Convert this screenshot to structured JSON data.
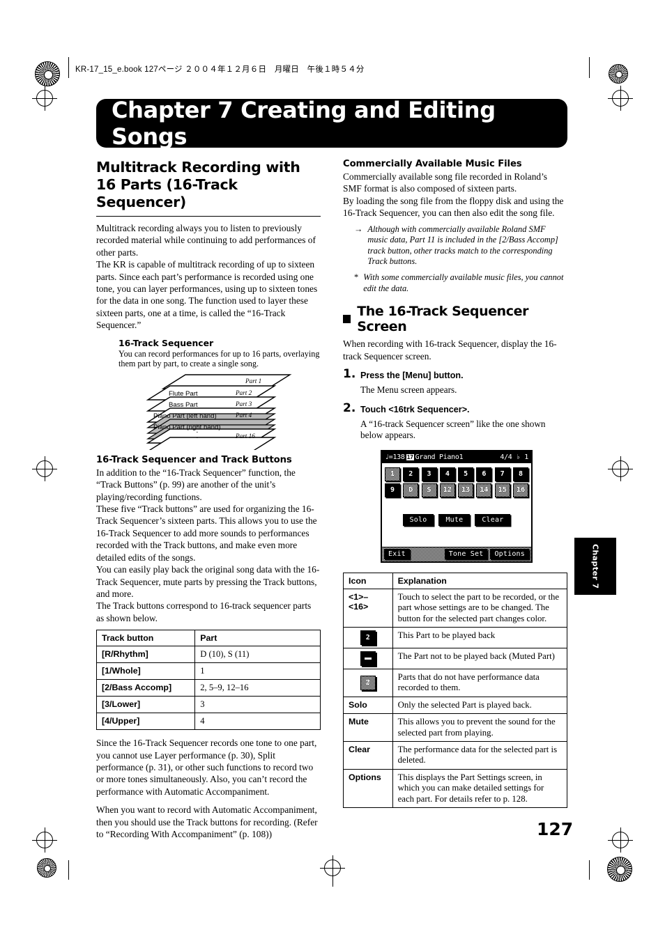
{
  "slug": {
    "text": "KR-17_15_e.book 127ページ ２００４年１２月６日　月曜日　午後１時５４分"
  },
  "chapter": {
    "banner_title": "Chapter 7 Creating and Editing Songs",
    "thumb_tab": "Chapter 7",
    "page_number": "127"
  },
  "left": {
    "section_title": "Multitrack Recording with 16 Parts (16-Track Sequencer)",
    "paras": [
      "Multitrack recording always you to listen to previously recorded material while continuing to add performances of other parts.",
      "The KR is capable of multitrack recording of up to sixteen parts. Since each part’s performance is recorded using one tone, you can layer performances, using up to sixteen tones for the data in one song. The function used to layer these sixteen parts, one at a time, is called the “16-Track Sequencer.”"
    ],
    "figure": {
      "caption": "16-Track Sequencer",
      "description": "You can record performances for up to 16 parts, overlaying them part by part, to create a single song.",
      "layer_labels": [
        "Flute Part",
        "Bass Part",
        "Piano Part (left hand)",
        "Piano Part (right hand)"
      ],
      "part_labels": [
        "Part 1",
        "Part 2",
        "Part 3",
        "Part 4",
        "Part 16"
      ]
    },
    "subsection_title": "16-Track Sequencer and Track Buttons",
    "sub_paras": [
      "In addition to the “16-Track Sequencer” function, the “Track Buttons” (p. 99) are another of the unit’s playing/recording functions.",
      "These five “Track buttons” are used for organizing the 16-Track Sequencer’s sixteen parts. This allows you to use the 16-Track Sequencer to add more sounds to performances recorded with the Track buttons, and make even more detailed edits of the songs.",
      "You can easily play back the original song data with the 16-Track Sequencer, mute parts by pressing the Track buttons, and more.",
      "The Track buttons correspond to 16-track sequencer parts as shown below."
    ],
    "track_table": {
      "headers": [
        "Track button",
        "Part"
      ],
      "rows": [
        [
          "[R/Rhythm]",
          "D (10), S (11)"
        ],
        [
          "[1/Whole]",
          "1"
        ],
        [
          "[2/Bass Accomp]",
          "2, 5–9, 12–16"
        ],
        [
          "[3/Lower]",
          "3"
        ],
        [
          "[4/Upper]",
          "4"
        ]
      ]
    },
    "closing_paras": [
      "Since the 16-Track Sequencer records one tone to one part, you cannot use Layer performance (p. 30), Split performance (p. 31), or other such functions to record two or more tones simultaneously. Also, you can’t record the performance with Automatic Accompaniment.",
      "When you want to record with Automatic Accompaniment, then you should use the Track buttons for recording. (Refer to “Recording With Accompaniment” (p. 108))"
    ]
  },
  "right": {
    "subsection_title": "Commercially Available Music Files",
    "paras": [
      "Commercially available song file recorded in Roland’s SMF format is also composed of sixteen parts.",
      "By loading the song file from the floppy disk and using the 16-Track Sequencer, you can then also edit the song file."
    ],
    "notes": [
      {
        "marker": "→",
        "text": "Although with commercially available Roland SMF music data, Part 11 is included in the [2/Bass Accomp] track button, other tracks match to the corresponding Track buttons."
      },
      {
        "marker": "*",
        "text": "With some commercially available music files, you cannot edit the data."
      }
    ],
    "block_title": "The 16-Track Sequencer Screen",
    "block_intro": "When recording with 16-track Sequencer, display the 16-track Sequencer screen.",
    "steps": [
      {
        "num": "1.",
        "heading": "Press the [Menu] button.",
        "body": "The Menu screen appears."
      },
      {
        "num": "2.",
        "heading": "Touch <16trk Sequencer>.",
        "body": "A “16-track Sequencer screen” like the one shown below appears."
      }
    ],
    "lcd": {
      "tempo": "♩=138",
      "tone_chip": "17",
      "tone_name": "Grand Piano1",
      "time_signature": "4/4",
      "measure_icon": "♭",
      "measure": "1",
      "pads_row1": [
        {
          "label": "1",
          "state": "empty"
        },
        {
          "label": "2",
          "state": "on"
        },
        {
          "label": "3",
          "state": "on"
        },
        {
          "label": "4",
          "state": "on"
        },
        {
          "label": "5",
          "state": "on"
        },
        {
          "label": "6",
          "state": "on"
        },
        {
          "label": "7",
          "state": "on"
        },
        {
          "label": "8",
          "state": "on"
        }
      ],
      "pads_row2": [
        {
          "label": "9",
          "state": "on"
        },
        {
          "label": "D",
          "state": "empty"
        },
        {
          "label": "S",
          "state": "empty"
        },
        {
          "label": "12",
          "state": "empty"
        },
        {
          "label": "13",
          "state": "empty"
        },
        {
          "label": "14",
          "state": "empty"
        },
        {
          "label": "15",
          "state": "empty"
        },
        {
          "label": "16",
          "state": "empty"
        }
      ],
      "buttons": [
        "Solo",
        "Mute",
        "Clear"
      ],
      "exit": "Exit",
      "tone_set": "Tone Set",
      "options": "Options"
    },
    "icon_table": {
      "headers": [
        "Icon",
        "Explanation"
      ],
      "rows": [
        {
          "icon_kind": "text",
          "icon_label": "<1>–\n<16>",
          "explanation": "Touch to select the part to be recorded, or the part whose settings are to be changed. The button for the selected part changes color."
        },
        {
          "icon_kind": "pad-on",
          "icon_label": "2",
          "explanation": "This Part to be played back"
        },
        {
          "icon_kind": "pad-muted",
          "icon_label": "–",
          "explanation": "The Part not to be played back (Muted Part)"
        },
        {
          "icon_kind": "pad-empty",
          "icon_label": "2",
          "explanation": "Parts that do not have performance data recorded to them."
        },
        {
          "icon_kind": "text",
          "icon_label": "Solo",
          "explanation": "Only the selected Part is played back."
        },
        {
          "icon_kind": "text",
          "icon_label": "Mute",
          "explanation": "This allows you to prevent the sound for the selected part from playing."
        },
        {
          "icon_kind": "text",
          "icon_label": "Clear",
          "explanation": "The performance data for the selected part is deleted."
        },
        {
          "icon_kind": "text",
          "icon_label": "Options",
          "explanation": "This displays the Part Settings screen, in which you can make detailed settings for each part. For details refer to p. 128."
        }
      ]
    }
  }
}
